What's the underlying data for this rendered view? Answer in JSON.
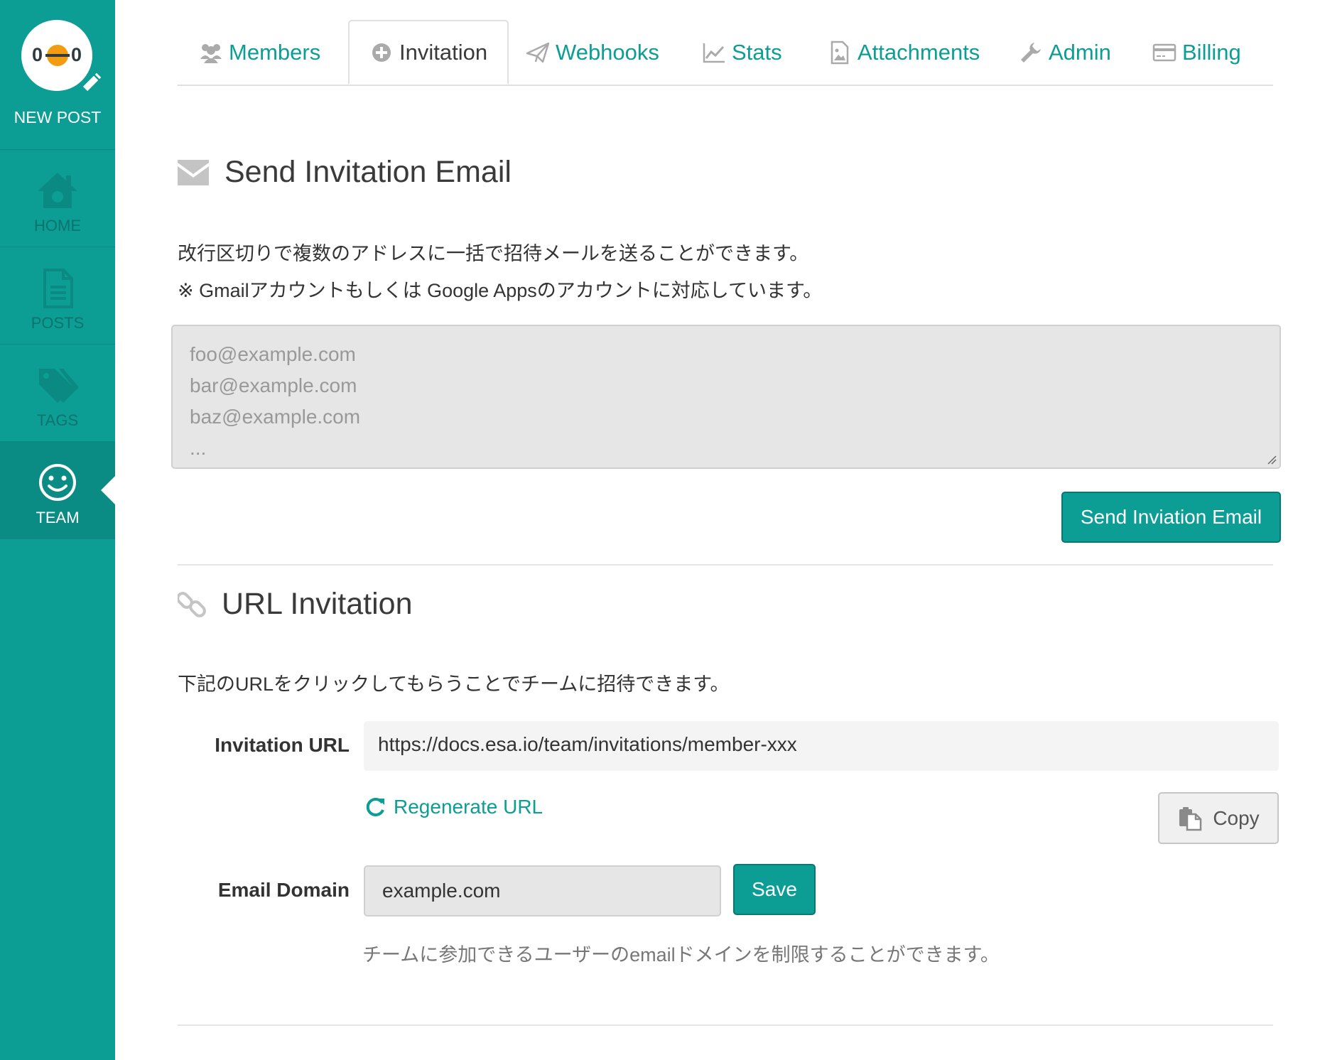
{
  "sidebar": {
    "new_post": {
      "label": "NEW POST",
      "logo_eye_left": "0",
      "logo_eye_right": "0"
    },
    "items": [
      {
        "label": "HOME",
        "icon": "home-icon",
        "active": false
      },
      {
        "label": "POSTS",
        "icon": "document-icon",
        "active": false
      },
      {
        "label": "TAGS",
        "icon": "tag-icon",
        "active": false
      },
      {
        "label": "TEAM",
        "icon": "smiley-icon",
        "active": true
      }
    ]
  },
  "tabs": [
    {
      "label": "Members",
      "icon": "users-icon",
      "active": false
    },
    {
      "label": "Invitation",
      "icon": "plus-circle-icon",
      "active": true
    },
    {
      "label": "Webhooks",
      "icon": "paper-plane-icon",
      "active": false
    },
    {
      "label": "Stats",
      "icon": "line-chart-icon",
      "active": false
    },
    {
      "label": "Attachments",
      "icon": "file-image-icon",
      "active": false
    },
    {
      "label": "Admin",
      "icon": "wrench-icon",
      "active": false
    },
    {
      "label": "Billing",
      "icon": "credit-card-icon",
      "active": false
    }
  ],
  "email_invitation": {
    "title": "Send Invitation Email",
    "icon": "envelope-icon",
    "desc_line1": "改行区切りで複数のアドレスに一括で招待メールを送ることができます。",
    "desc_line2": "※ Gmailアカウントもしくは Google Appsのアカウントに対応しています。",
    "placeholder_lines": [
      "foo@example.com",
      "bar@example.com",
      "baz@example.com",
      "..."
    ],
    "send_button": "Send Inviation Email"
  },
  "url_invitation": {
    "title": "URL Invitation",
    "icon": "link-icon",
    "desc": "下記のURLをクリックしてもらうことでチームに招待できます。",
    "url_label": "Invitation URL",
    "url_value": "https://docs.esa.io/team/invitations/member-xxx",
    "regenerate_label": "Regenerate URL",
    "copy_label": "Copy",
    "domain_label": "Email Domain",
    "domain_value": "example.com",
    "save_label": "Save",
    "domain_hint": "チームに参加できるユーザーのemailドメインを制限することができます。"
  },
  "colors": {
    "brand": "#0c9d94",
    "brand_dark": "#087870",
    "sidebar_text": "#0a746d",
    "logo_accent": "#f39c12"
  }
}
